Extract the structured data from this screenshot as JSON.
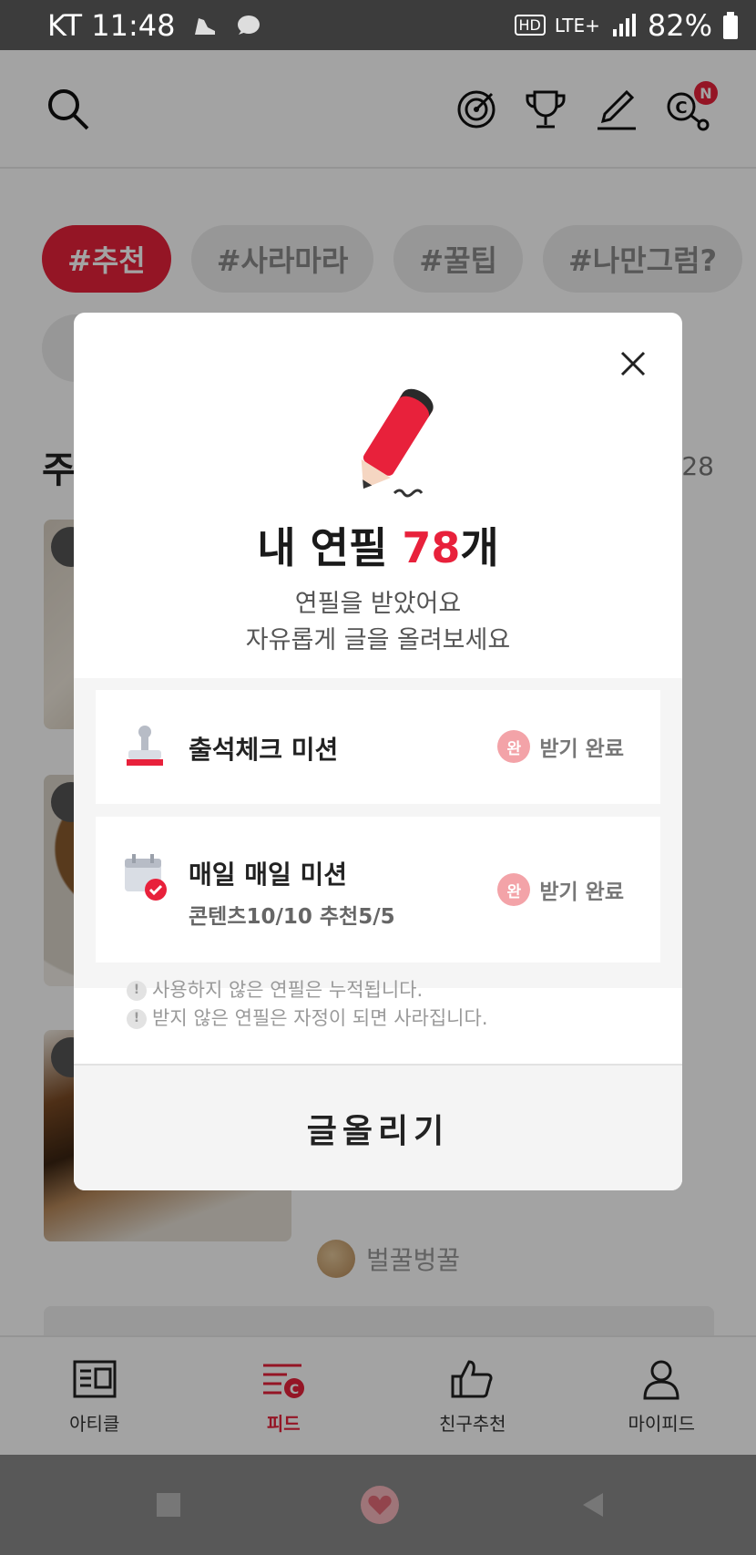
{
  "status_bar": {
    "carrier_time": "KT 11:48",
    "network": "LTE+",
    "hd": "HD",
    "battery": "82%"
  },
  "header": {
    "icons": [
      "search-icon",
      "target-icon",
      "trophy-icon",
      "pencil-icon",
      "share-c-icon"
    ],
    "notification_badge": "N"
  },
  "chips": [
    "#추천",
    "#사라마라",
    "#꿀팁",
    "#나만그럼?"
  ],
  "feed": {
    "section_title": "주",
    "section_count": "28",
    "username": "벌꿀벙꿀"
  },
  "bottom_nav": [
    {
      "label": "아티클",
      "active": false
    },
    {
      "label": "피드",
      "active": true
    },
    {
      "label": "친구추천",
      "active": false
    },
    {
      "label": "마이피드",
      "active": false
    }
  ],
  "modal": {
    "headline_prefix": "내 연필 ",
    "headline_count": "78",
    "headline_suffix": "개",
    "subtitle_line1": "연필을 받았어요",
    "subtitle_line2": "자유롭게 글을 올려보세요",
    "missions": [
      {
        "title": "출석체크 미션",
        "detail": "",
        "badge": "완",
        "status": "받기 완료"
      },
      {
        "title": "매일 매일 미션",
        "detail": "콘텐츠10/10  추천5/5",
        "badge": "완",
        "status": "받기 완료"
      }
    ],
    "notes": [
      {
        "icon": "!",
        "text": "사용하지 않은 연필은 누적됩니다."
      },
      {
        "icon": "!",
        "text": "받지 않은 연필은 자정이 되면 사라집니다."
      }
    ],
    "post_button": "글올리기"
  },
  "colors": {
    "accent": "#e8213b",
    "badge_done": "#f3a3a8",
    "overlay": "rgba(0,0,0,0.36)"
  }
}
